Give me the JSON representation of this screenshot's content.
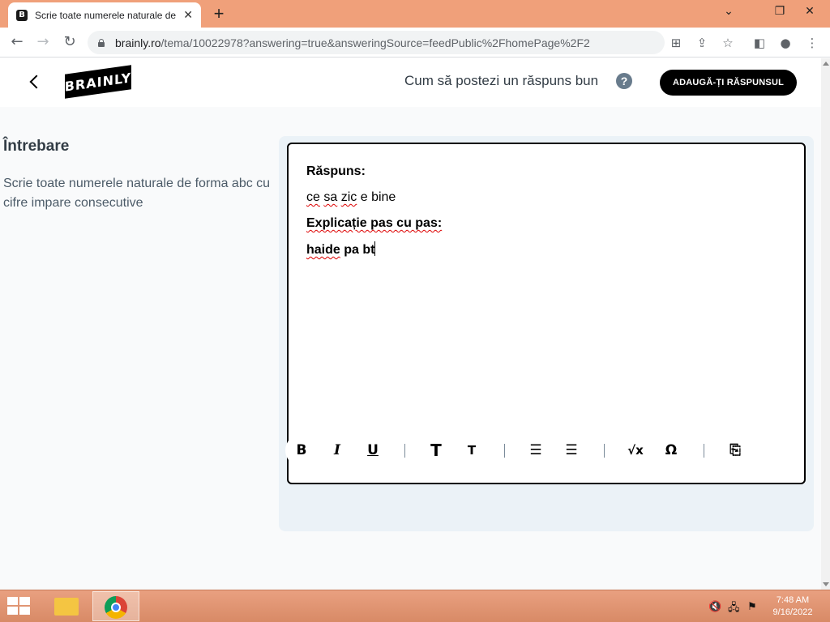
{
  "browser": {
    "tab_title": "Scrie toate numerele naturale de",
    "tab_favicon": "B",
    "tab_close": "✕",
    "new_tab": "+",
    "url_host": "brainly.ro",
    "url_path": "/tema/10022978?answering=true&answeringSource=feedPublic%2FhomePage%2F2",
    "window_controls": [
      "⌄",
      "❐",
      "✕"
    ]
  },
  "header": {
    "logo_text": "BRAINLY",
    "howto_link": "Cum să postezi un răspuns bun",
    "help_icon": "?",
    "add_answer_button": "ADAUGĂ-ȚI RĂSPUNSUL"
  },
  "question": {
    "heading": "Întrebare",
    "text": "Scrie toate numerele naturale de forma abc cu cifre impare consecutive"
  },
  "editor": {
    "answer_label": "Răspuns:",
    "answer_words": [
      "ce",
      "sa",
      "zic",
      "e bine"
    ],
    "explanation_label": "Explicație pas cu pas:",
    "explanation_words": [
      "haide",
      "pa",
      "bt"
    ]
  },
  "format_toolbar": {
    "bold": "B",
    "italic": "I",
    "underline": "U",
    "heading_large": "T",
    "heading_small": "T",
    "ordered_list": "☰",
    "unordered_list": "☰",
    "math": "√x",
    "special_chars": "Ω",
    "attachment": "⎘"
  },
  "taskbar": {
    "time": "7:48 AM",
    "date": "9/16/2022"
  }
}
